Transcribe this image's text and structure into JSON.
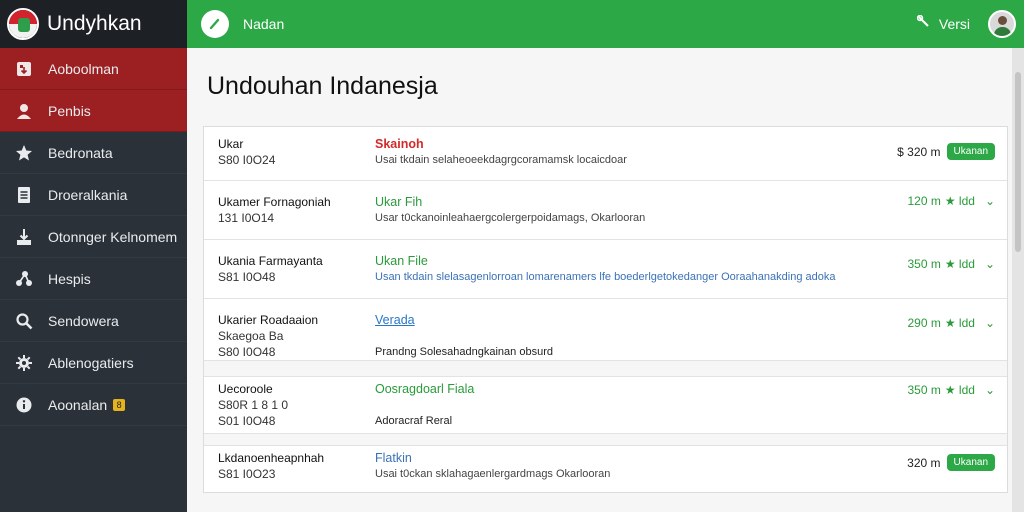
{
  "app": {
    "title": "Undyhkan",
    "topbar_title": "Nadan",
    "version_label": "Versi",
    "page_title": "Undouhan Indanesja"
  },
  "sidebar": {
    "items": [
      {
        "label": "Aoboolman",
        "icon": "download-icon",
        "active": true
      },
      {
        "label": "Penbis",
        "icon": "user-icon",
        "active": true
      },
      {
        "label": "Bedronata",
        "icon": "star-icon",
        "active": false
      },
      {
        "label": "Droeralkania",
        "icon": "document-icon",
        "active": false
      },
      {
        "label": "Otonnger Kelnomem",
        "icon": "download-box-icon",
        "active": false
      },
      {
        "label": "Hespis",
        "icon": "share-icon",
        "active": false
      },
      {
        "label": "Sendowera",
        "icon": "search-icon",
        "active": false
      },
      {
        "label": "Ablenogatiers",
        "icon": "gear-icon",
        "active": false
      },
      {
        "label": "Aoonalan",
        "icon": "info-icon",
        "active": false,
        "badge": "8"
      }
    ]
  },
  "rows": [
    {
      "name": "Ukar",
      "sub1": "S80 I0O24",
      "title": "Skainoh",
      "title_style": "red",
      "desc": "Usai tkdain selaheoeekdagrgcoramamsk locaicdoar",
      "size": "$ 320 m",
      "size_style": "dark",
      "action": "Ukanan"
    },
    {
      "name": "Ukamer Fornagoniah",
      "sub1": "131 I0O14",
      "title": "Ukar Fih",
      "title_style": "green",
      "desc": "Usar t0ckanoinleahaergcolergerpoidamags, Okarlooran",
      "size": "120 m",
      "rating": "★ ldd"
    },
    {
      "name": "Ukania Farmayanta",
      "sub1": "S81 I0O48",
      "title": "Ukan File",
      "title_style": "green",
      "desc": "Usan tkdain slelasagenlorroan lomarenamers lfe boederlgetokedanger Ooraahanakding adoka",
      "size": "350 m",
      "rating": "★ ldd"
    },
    {
      "name": "Ukarier Roadaaion",
      "sub1": "Skaegoa Ba",
      "sub2": "S80 I0O48",
      "title": "Verada",
      "title_style": "blue",
      "desc": "Prandng Solesahadngkainan obsurd",
      "size": "290 m",
      "rating": "★ ldd"
    },
    {
      "name": "Uecoroole",
      "sub1": "S80R 1 8 1 0",
      "sub2": "S01 I0O48",
      "title": "Oosragdoarl Fiala",
      "title_style": "green",
      "desc": "Adoracraf Reral",
      "size": "350 m",
      "rating": "★ ldd"
    },
    {
      "name": "Lkdanoenheapnhah",
      "sub1": "S81 I0O23",
      "title": "Flatkin",
      "title_style": "bluetext",
      "desc": "Usai t0ckan sklahagaenlergardmags Okarlooran",
      "size": "320 m",
      "size_style": "dark",
      "action": "Ukanan"
    }
  ],
  "colors": {
    "sidebar_bg": "#2b3138",
    "active_red": "#9c1f22",
    "topbar_green": "#2ca847"
  }
}
